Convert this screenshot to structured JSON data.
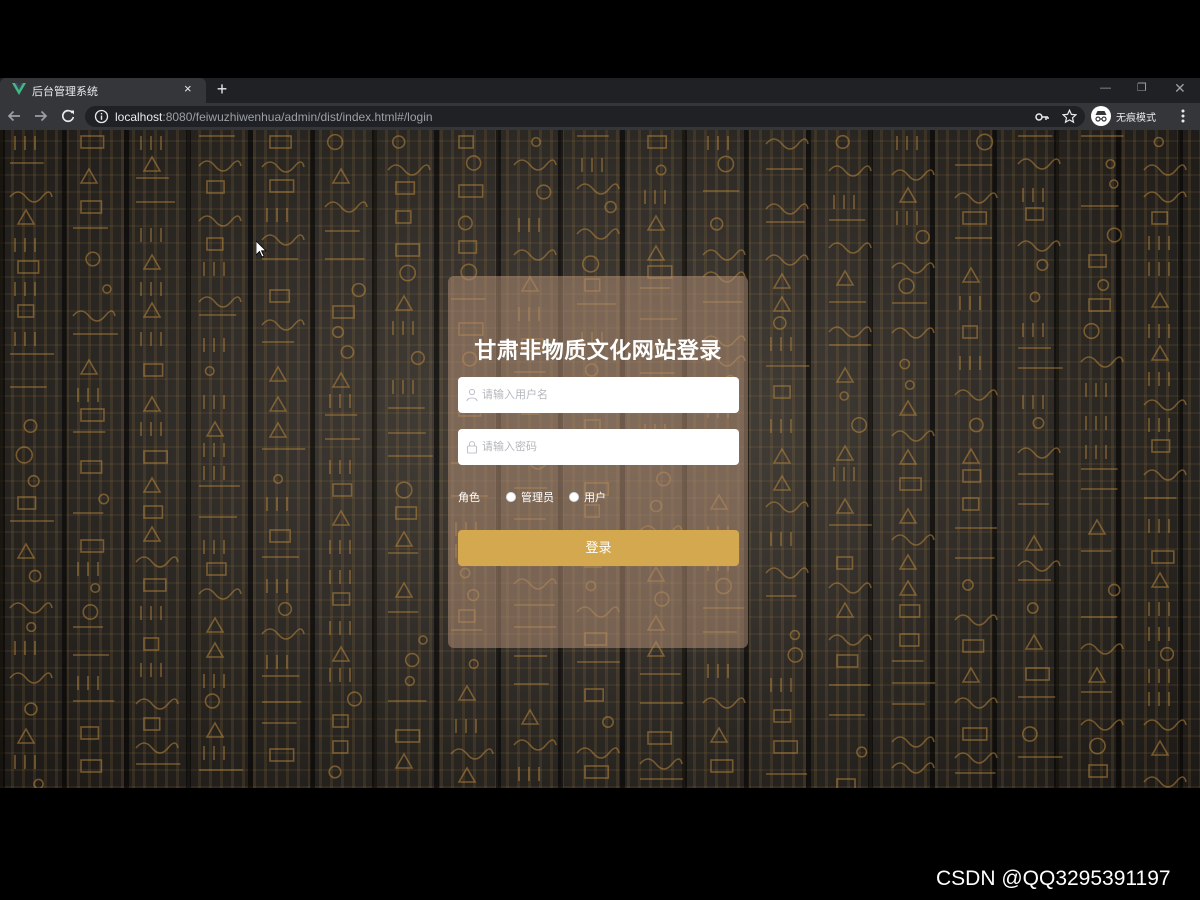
{
  "browser": {
    "tab": {
      "title": "后台管理系统",
      "close_glyph": "×",
      "favicon": "vue-logo-icon"
    },
    "new_tab_glyph": "+",
    "window_controls": {
      "minimize": "—",
      "maximize": "❐",
      "close": "✕"
    },
    "address": {
      "host": "localhost",
      "rest": ":8080/feiwuzhiwenhua/admin/dist/index.html#/login"
    },
    "incognito_label": "无痕模式"
  },
  "login": {
    "title": "甘肃非物质文化网站登录",
    "username_placeholder": "请输入用户名",
    "password_placeholder": "请输入密码",
    "role_label": "角色",
    "roles": [
      "管理员",
      "用户"
    ],
    "submit_label": "登录"
  },
  "colors": {
    "accent_button": "#d4a84e",
    "card_overlay": "rgba(175,140,115,0.55)",
    "vue_green": "#42b883"
  },
  "watermark": "CSDN @QQ3295391197"
}
